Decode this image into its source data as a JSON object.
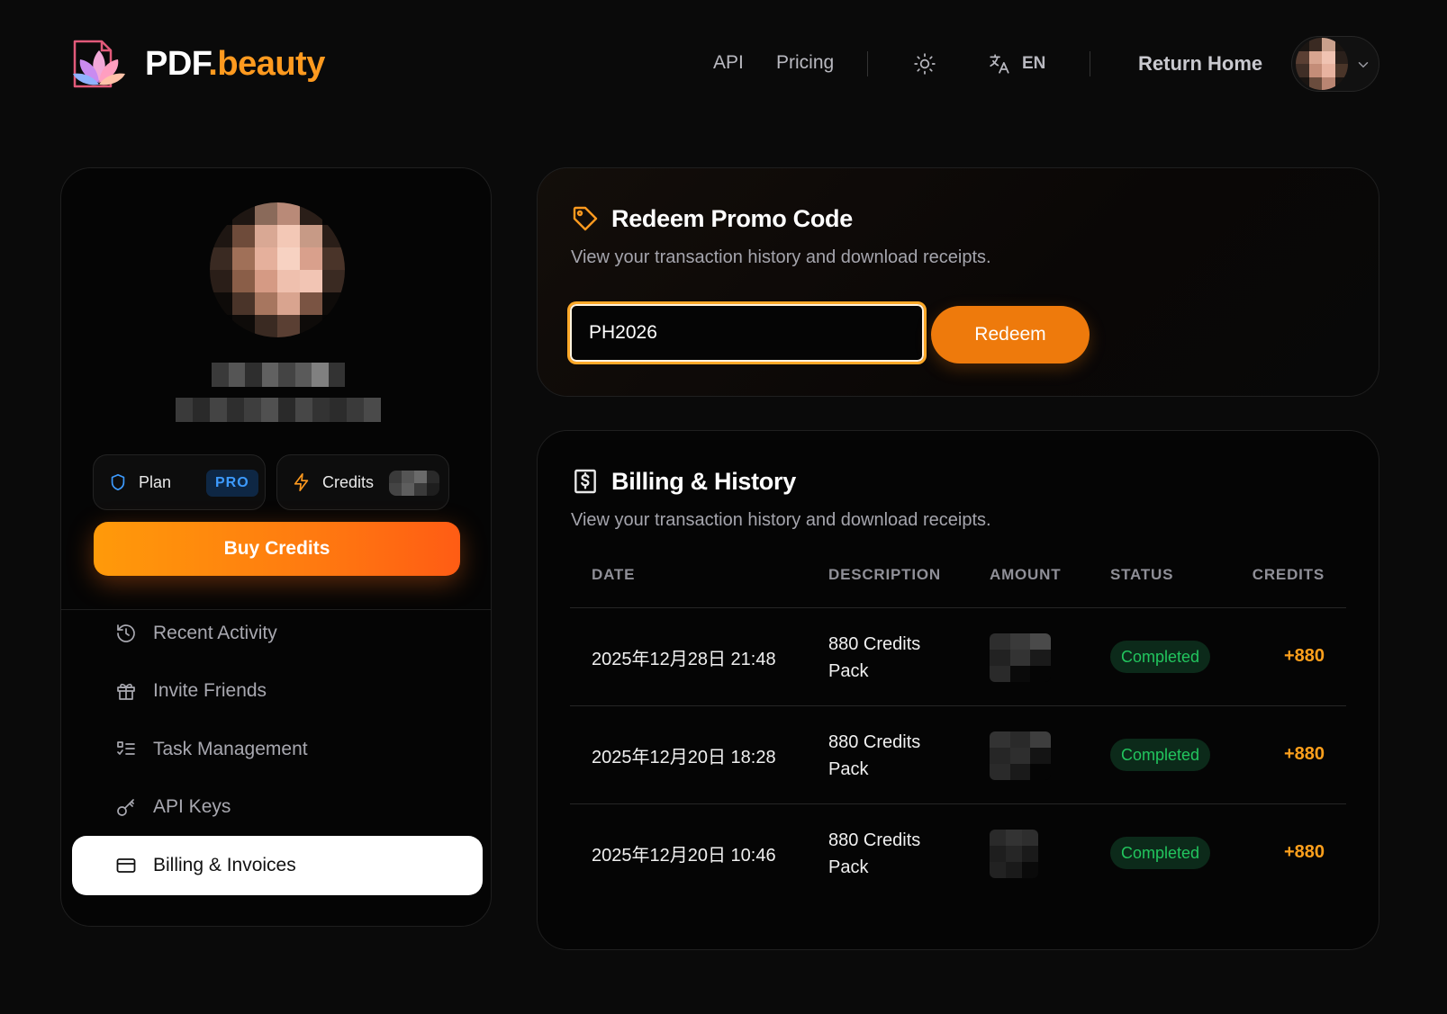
{
  "brand": {
    "name_main": "PDF",
    "name_accent": ".beauty"
  },
  "nav": {
    "api": "API",
    "pricing": "Pricing",
    "language": "EN",
    "return_home": "Return Home"
  },
  "colors": {
    "accent": "#ff9a1f",
    "background": "#0a0a0a",
    "status_green": "#22c55e",
    "pro_blue": "#3d9bff"
  },
  "profile": {
    "plan_label": "Plan",
    "plan_badge": "PRO",
    "credits_label": "Credits",
    "buy_credits": "Buy Credits"
  },
  "sidebar": {
    "items": [
      {
        "label": "Recent Activity",
        "icon": "history-icon",
        "active": false
      },
      {
        "label": "Invite Friends",
        "icon": "gift-icon",
        "active": false
      },
      {
        "label": "Task Management",
        "icon": "task-list-icon",
        "active": false
      },
      {
        "label": "API Keys",
        "icon": "key-icon",
        "active": false
      },
      {
        "label": "Billing & Invoices",
        "icon": "credit-card-icon",
        "active": true
      }
    ]
  },
  "promo": {
    "title": "Redeem Promo Code",
    "subtitle": "View your transaction history and download receipts.",
    "input_value": "PH2026",
    "button": "Redeem"
  },
  "billing": {
    "title": "Billing & History",
    "subtitle": "View your transaction history and download receipts.",
    "columns": [
      "DATE",
      "DESCRIPTION",
      "AMOUNT",
      "STATUS",
      "CREDITS"
    ],
    "rows": [
      {
        "date": "2025年12月28日 21:48",
        "description": "880 Credits Pack",
        "status": "Completed",
        "credits": "+880"
      },
      {
        "date": "2025年12月20日 18:28",
        "description": "880 Credits Pack",
        "status": "Completed",
        "credits": "+880"
      },
      {
        "date": "2025年12月20日 10:46",
        "description": "880 Credits Pack",
        "status": "Completed",
        "credits": "+880"
      }
    ]
  }
}
